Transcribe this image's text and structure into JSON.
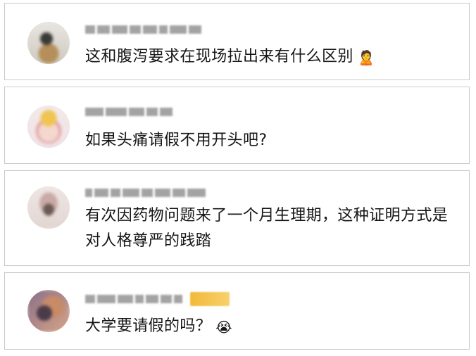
{
  "comments": [
    {
      "text": "这和腹泻要求在现场拉出来有什么区别",
      "emoji": "🙎"
    },
    {
      "text": "如果头痛请假不用开头吧?",
      "emoji": ""
    },
    {
      "text": "有次因药物问题来了一个月生理期，这种证明方式是对人格尊严的践踏",
      "emoji": ""
    },
    {
      "text": "大学要请假的吗？",
      "emoji": "😭"
    }
  ],
  "colors": {
    "card_border": "#c9c9c9",
    "text": "#161616",
    "badge": "#f2b93a"
  },
  "icons": [
    "person-bowing-icon",
    "crying-face-icon"
  ]
}
